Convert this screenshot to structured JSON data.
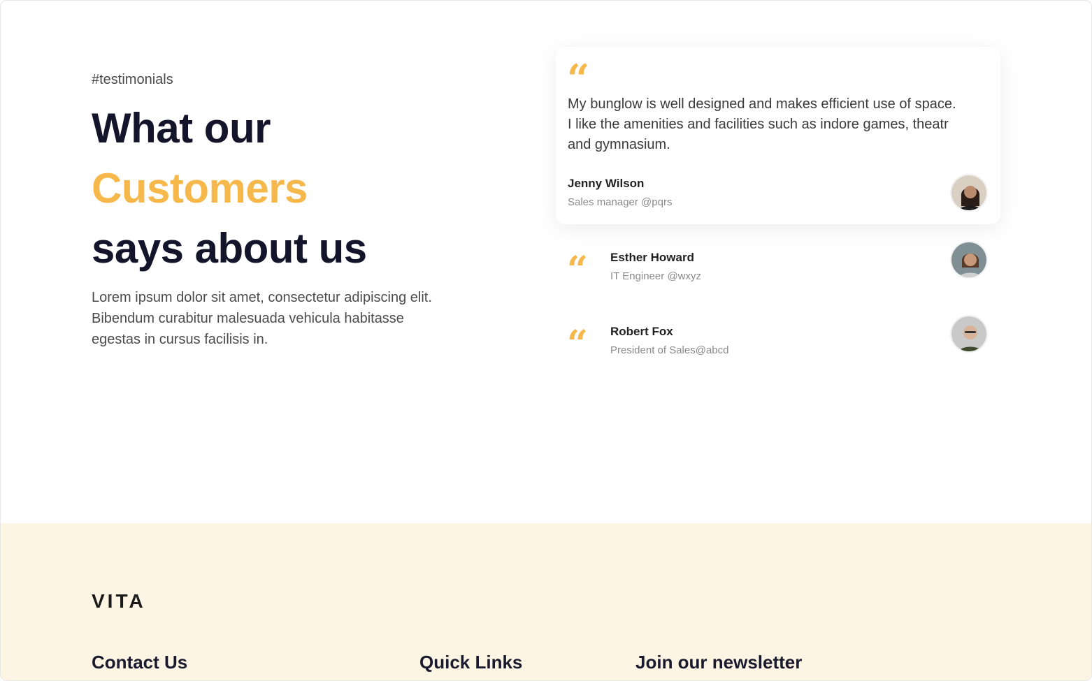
{
  "testimonials_section": {
    "tag": "#testimonials",
    "headline_line1": "What our",
    "headline_line2": "Customers",
    "headline_line3": "says about us",
    "lead": "Lorem ipsum dolor sit amet, consectetur adipiscing elit. Bibendum curabitur malesuada vehicula habitasse egestas in cursus facilisis in."
  },
  "featured": {
    "quote_mark": "“",
    "text": "My bunglow is well designed and makes efficient use of space. I like the amenities and facilities such as indore games, theatr and gymnasium.",
    "name": "Jenny Wilson",
    "role": "Sales manager @pqrs"
  },
  "list": [
    {
      "quote_mark": "“",
      "name": "Esther Howard",
      "role": "IT Engineer @wxyz"
    },
    {
      "quote_mark": "“",
      "name": "Robert Fox",
      "role": "President of Sales@abcd"
    }
  ],
  "footer": {
    "logo": "VITA",
    "contact_heading": "Contact Us",
    "links_heading": "Quick Links",
    "newsletter_heading": "Join our newsletter"
  },
  "colors": {
    "accent": "#f7b84b",
    "footer_bg": "#fdf5e4",
    "heading": "#14142b"
  },
  "icons": {
    "quote": "quote-icon",
    "avatar": "user-avatar"
  }
}
